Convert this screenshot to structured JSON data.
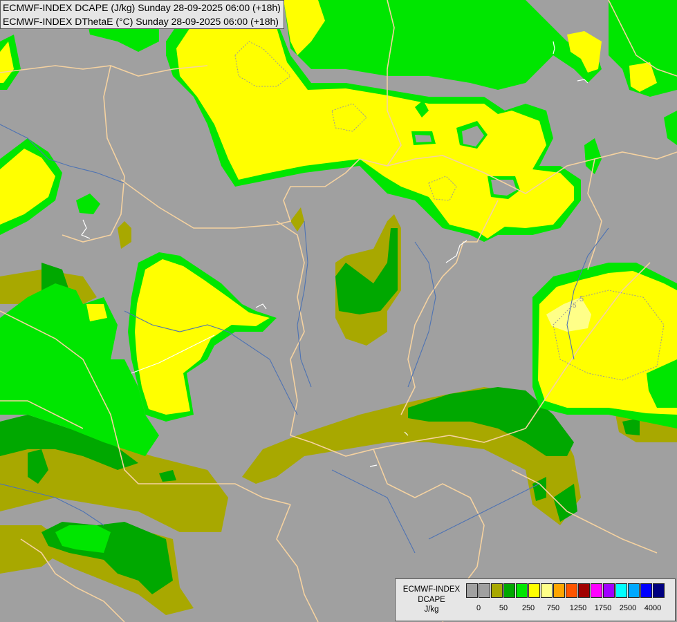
{
  "header": {
    "line1": "ECMWF-INDEX DCAPE (J/kg) Sunday 28-09-2025 06:00 (+18h)",
    "line2": "ECMWF-INDEX DThetaE (°C) Sunday 28-09-2025 06:00 (+18h)"
  },
  "map": {
    "contour_labels": [
      "5",
      "5"
    ]
  },
  "legend": {
    "title_lines": [
      "ECMWF-INDEX",
      "DCAPE",
      "J/kg"
    ],
    "colors": [
      "#a0a0a0",
      "#a0a0a0",
      "#a8a800",
      "#00a800",
      "#00e600",
      "#ffff00",
      "#ffff88",
      "#ffa500",
      "#ff5500",
      "#a00000",
      "#ff00ff",
      "#a000ff",
      "#00ffff",
      "#00a8ff",
      "#0000ff",
      "#000080"
    ],
    "tick_labels": [
      "0",
      "50",
      "250",
      "750",
      "1250",
      "1750",
      "2500",
      "4000"
    ]
  },
  "palette": {
    "background": "#a0a0a0",
    "olive": "#a8a800",
    "dark_green": "#00a800",
    "green": "#00e600",
    "yellow": "#ffff00",
    "light_yellow": "#ffff88",
    "borders": "#f5d2a0",
    "rivers": "#4e73b3",
    "coast": "#ffffff"
  }
}
